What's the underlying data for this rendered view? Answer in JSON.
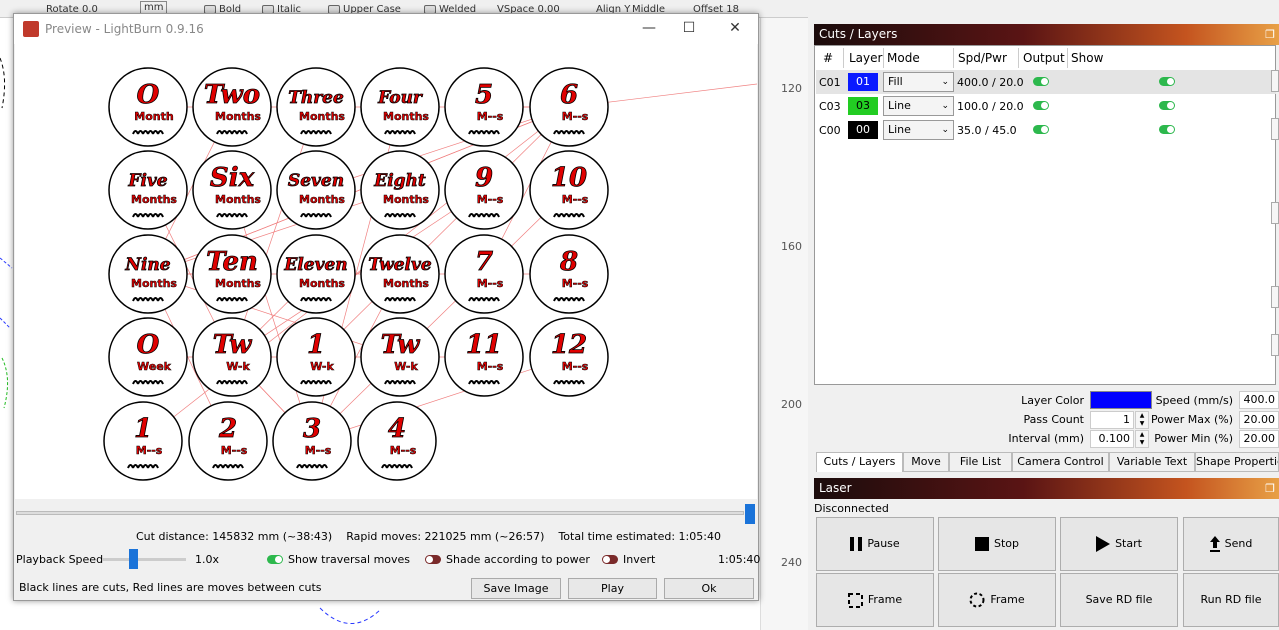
{
  "toolbar": {
    "rotate_label": "Rotate",
    "rotate_value": "0.0",
    "unit": "mm",
    "bold": "Bold",
    "italic": "Italic",
    "upper_case": "Upper Case",
    "welded": "Welded",
    "vspace": "VSpace 0.00",
    "align_y": "Align Y",
    "align_y_value": "Middle",
    "offset": "Offset 18"
  },
  "ruler": {
    "ticks": [
      "120",
      "160",
      "200",
      "240"
    ]
  },
  "preview": {
    "title": "Preview - LightBurn 0.9.16",
    "cut_distance": "Cut distance: 145832 mm (~38:43)",
    "rapid_moves": "Rapid moves: 221025 mm (~26:57)",
    "total_time": "Total time estimated: 1:05:40",
    "playback_speed_label": "Playback Speed",
    "playback_speed_value": "1.0x",
    "show_traversal": "Show traversal moves",
    "shade_power": "Shade according to power",
    "invert": "Invert",
    "time_display": "1:05:40",
    "hint": "Black lines are cuts, Red lines are moves between cuts",
    "save_image": "Save Image",
    "play": "Play",
    "ok": "Ok",
    "badges": [
      {
        "big": "O",
        "sub": "Month"
      },
      {
        "big": "Two",
        "sub": "Months"
      },
      {
        "big": "Three",
        "sub": "Months"
      },
      {
        "big": "Four",
        "sub": "Months"
      },
      {
        "big": "5",
        "sub": "M--s"
      },
      {
        "big": "6",
        "sub": "M--s"
      },
      {
        "big": "Five",
        "sub": "Months"
      },
      {
        "big": "Six",
        "sub": "Months"
      },
      {
        "big": "Seven",
        "sub": "Months"
      },
      {
        "big": "Eight",
        "sub": "Months"
      },
      {
        "big": "9",
        "sub": "M--s"
      },
      {
        "big": "10",
        "sub": "M--s"
      },
      {
        "big": "Nine",
        "sub": "Months"
      },
      {
        "big": "Ten",
        "sub": "Months"
      },
      {
        "big": "Eleven",
        "sub": "Months"
      },
      {
        "big": "Twelve",
        "sub": "Months"
      },
      {
        "big": "7",
        "sub": "M--s"
      },
      {
        "big": "8",
        "sub": "M--s"
      },
      {
        "big": "O",
        "sub": "Week"
      },
      {
        "big": "Tw",
        "sub": "W-k"
      },
      {
        "big": "1",
        "sub": "W-k"
      },
      {
        "big": "Tw",
        "sub": "W-k"
      },
      {
        "big": "11",
        "sub": "M--s"
      },
      {
        "big": "12",
        "sub": "M--s"
      },
      {
        "big": "1",
        "sub": "M--s"
      },
      {
        "big": "2",
        "sub": "M--s"
      },
      {
        "big": "3",
        "sub": "M--s"
      },
      {
        "big": "4",
        "sub": "M--s"
      }
    ]
  },
  "cuts_layers": {
    "title": "Cuts / Layers",
    "headers": [
      "#",
      "Layer",
      "Mode",
      "Spd/Pwr",
      "Output",
      "Show"
    ],
    "rows": [
      {
        "id": "C01",
        "layer": "01",
        "color": "#0a1aff",
        "text_color": "#ffffff",
        "mode": "Fill",
        "spd_pwr": "400.0 / 20.0"
      },
      {
        "id": "C03",
        "layer": "03",
        "color": "#22cc22",
        "text_color": "#000000",
        "mode": "Line",
        "spd_pwr": "100.0 / 20.0"
      },
      {
        "id": "C00",
        "layer": "00",
        "color": "#000000",
        "text_color": "#ffffff",
        "mode": "Line",
        "spd_pwr": "35.0 / 45.0"
      }
    ],
    "layer_color_label": "Layer Color",
    "layer_color": "#0000ff",
    "speed_label": "Speed (mm/s)",
    "speed_value": "400.0",
    "pass_count_label": "Pass Count",
    "pass_count_value": "1",
    "power_max_label": "Power Max (%)",
    "power_max_value": "20.00",
    "interval_label": "Interval (mm)",
    "interval_value": "0.100",
    "power_min_label": "Power Min (%)",
    "power_min_value": "20.00"
  },
  "tabs": [
    "Cuts / Layers",
    "Move",
    "File List",
    "Camera Control",
    "Variable Text",
    "Shape Properties"
  ],
  "laser": {
    "title": "Laser",
    "status": "Disconnected",
    "buttons": [
      "Pause",
      "Stop",
      "Start",
      "Send",
      "Frame",
      "Frame",
      "Save RD file",
      "Run RD file"
    ]
  }
}
